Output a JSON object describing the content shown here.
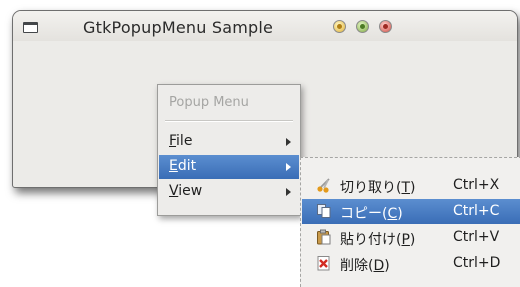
{
  "window": {
    "title": "GtkPopupMenu Sample"
  },
  "popup_menu": {
    "header": "Popup Menu",
    "items": [
      {
        "mnemonic": "F",
        "rest": "ile"
      },
      {
        "mnemonic": "E",
        "rest": "dit",
        "selected": true
      },
      {
        "mnemonic": "V",
        "rest": "iew"
      }
    ]
  },
  "edit_submenu": {
    "items": [
      {
        "icon": "scissors-icon",
        "label_prefix": "切り取り(",
        "mnemonic": "T",
        "label_suffix": ")",
        "accel": "Ctrl+X"
      },
      {
        "icon": "copy-icon",
        "label_prefix": "コピー(",
        "mnemonic": "C",
        "label_suffix": ")",
        "accel": "Ctrl+C",
        "selected": true
      },
      {
        "icon": "paste-icon",
        "label_prefix": "貼り付け(",
        "mnemonic": "P",
        "label_suffix": ")",
        "accel": "Ctrl+V"
      },
      {
        "icon": "delete-icon",
        "label_prefix": "削除(",
        "mnemonic": "D",
        "label_suffix": ")",
        "accel": "Ctrl+D"
      }
    ]
  },
  "colors": {
    "selection": "#3a6db6",
    "window_bg": "#ecebe8"
  }
}
